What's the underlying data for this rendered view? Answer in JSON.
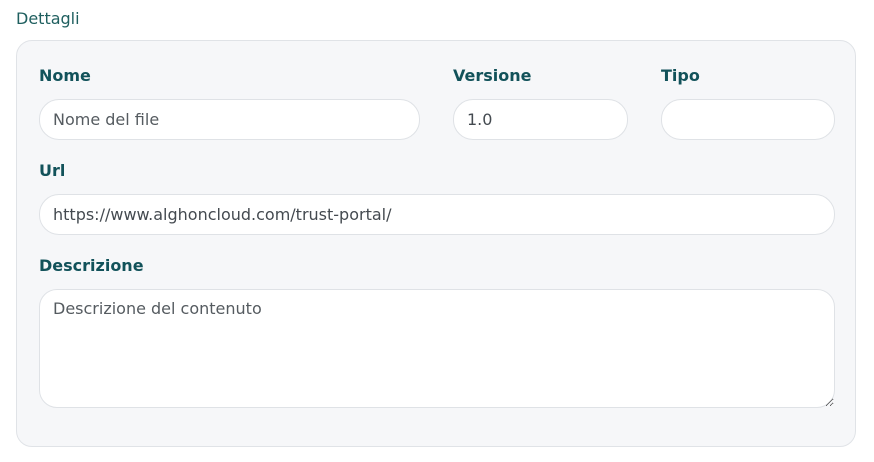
{
  "section": {
    "title": "Dettagli"
  },
  "form": {
    "nome": {
      "label": "Nome",
      "placeholder": "Nome del file",
      "value": ""
    },
    "versione": {
      "label": "Versione",
      "placeholder": "",
      "value": "1.0"
    },
    "tipo": {
      "label": "Tipo",
      "placeholder": "",
      "value": ""
    },
    "url": {
      "label": "Url",
      "placeholder": "",
      "value": "https://www.alghoncloud.com/trust-portal/"
    },
    "descrizione": {
      "label": "Descrizione",
      "placeholder": "Descrizione del contenuto",
      "value": ""
    }
  },
  "colors": {
    "label": "#12525a",
    "card_background": "#f6f7f9",
    "field_border": "#dfe2e6"
  }
}
